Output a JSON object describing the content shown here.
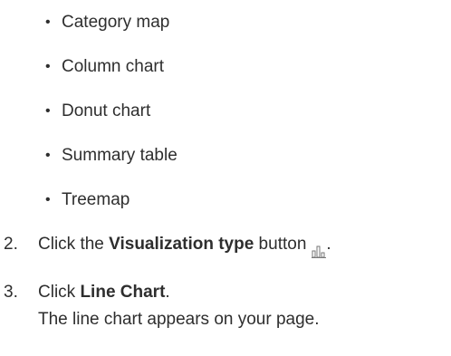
{
  "bullet_items": [
    "Category map",
    "Column chart",
    "Donut chart",
    "Summary table",
    "Treemap"
  ],
  "bullet_glyph": "•",
  "steps": [
    {
      "number": "2.",
      "pre": "Click the ",
      "bold": "Visualization type",
      "post": " button",
      "icon": "visualization-type-icon"
    },
    {
      "number": "3.",
      "pre": "Click ",
      "bold": "Line Chart",
      "post": ".",
      "result": "The line chart appears on your page."
    }
  ]
}
